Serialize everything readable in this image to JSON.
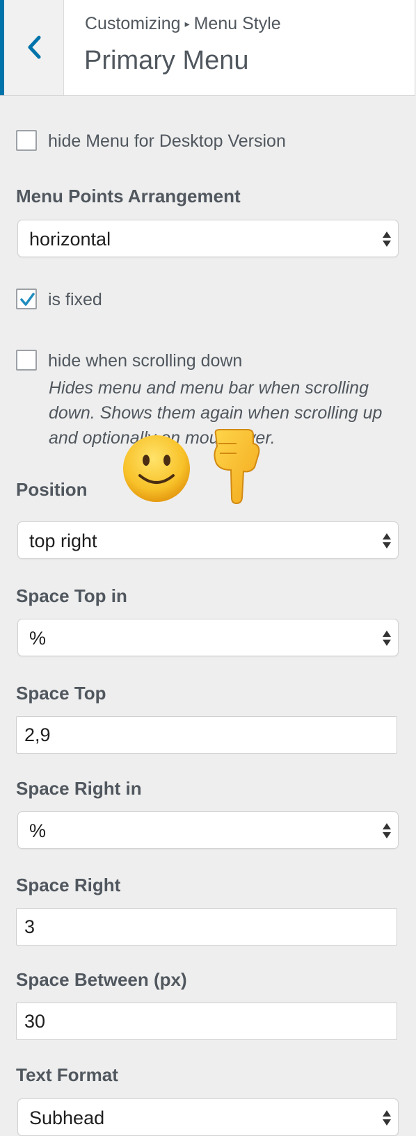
{
  "header": {
    "breadcrumb_parent": "Customizing",
    "breadcrumb_separator": "▸",
    "breadcrumb_section": "Menu Style",
    "title": "Primary Menu"
  },
  "controls": {
    "hide_desktop": {
      "label": "hide Menu for Desktop Version",
      "checked": false
    },
    "arrangement": {
      "label": "Menu Points Arrangement",
      "value": "horizontal"
    },
    "is_fixed": {
      "label": "is fixed",
      "checked": true
    },
    "hide_scroll": {
      "label": "hide when scrolling down",
      "description": "Hides menu and menu bar when scrolling down. Shows them again when scrolling up and optionally on mouseover.",
      "checked": false
    },
    "position": {
      "label": "Position",
      "value": "top right"
    },
    "space_top_unit": {
      "label": "Space Top in",
      "value": "%"
    },
    "space_top": {
      "label": "Space Top",
      "value": "2,9"
    },
    "space_right_unit": {
      "label": "Space Right in",
      "value": "%"
    },
    "space_right": {
      "label": "Space Right",
      "value": "3"
    },
    "space_between": {
      "label": "Space Between (px)",
      "value": "30"
    },
    "text_format": {
      "label": "Text Format",
      "value": "Subhead"
    }
  },
  "overlay": {
    "emoji_1": "slightly-smiling-face",
    "emoji_2": "pointing-down-hand"
  },
  "colors": {
    "accent": "#0073aa",
    "check": "#1e8cbe",
    "panel_bg": "#eeeeee",
    "text": "#50575e"
  }
}
